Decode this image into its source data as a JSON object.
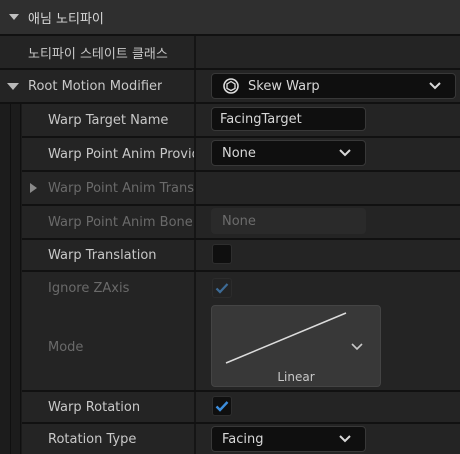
{
  "section": {
    "title": "애님 노티파이",
    "expanded": true
  },
  "rows": {
    "notify_class": {
      "label": "노티파이 스테이트 클래스"
    },
    "root_motion_modifier": {
      "label": "Root Motion Modifier",
      "value": "Skew Warp",
      "icon": "unreal-logo-icon"
    },
    "warp_target_name": {
      "label": "Warp Target Name",
      "value": "FacingTarget"
    },
    "warp_point_provider": {
      "label": "Warp Point Anim Provider",
      "value": "None"
    },
    "warp_point_transform": {
      "label": "Warp Point Anim Transf..."
    },
    "warp_point_bone": {
      "label": "Warp Point Anim Bone...",
      "value": "None"
    },
    "warp_translation": {
      "label": "Warp Translation",
      "checked": false
    },
    "ignore_zaxis": {
      "label": "Ignore ZAxis",
      "checked": true,
      "enabled": false
    },
    "mode": {
      "label": "Mode",
      "value": "Linear"
    },
    "warp_rotation": {
      "label": "Warp Rotation",
      "checked": true
    },
    "rotation_type": {
      "label": "Rotation Type",
      "value": "Facing"
    }
  },
  "colors": {
    "accent_check": "#3c8ddc",
    "dim_check": "#3d6b96"
  }
}
